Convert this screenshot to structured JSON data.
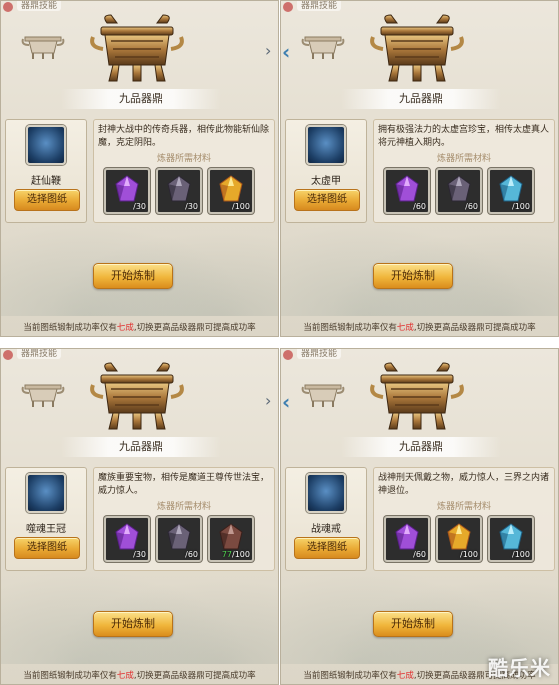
{
  "header_tag": "器鼎技能",
  "cauldron_title": "九品器鼎",
  "materials_label": "炼器所需材料",
  "select_button_label": "选择图纸",
  "craft_button_label": "开始炼制",
  "tip": {
    "before": "当前图纸锻制成功率仅有",
    "rate": "七成",
    "after": ",切换更高品级器鼎可提高成功率"
  },
  "panels": [
    {
      "item_name": "赶仙鞭",
      "description": "封神大战中的传奇兵器，相传此物能斩仙除魔，克定阴阳。",
      "materials": [
        {
          "icon": "purple-crystal-icon",
          "have": "",
          "need": "30"
        },
        {
          "icon": "dark-ore-icon",
          "have": "",
          "need": "30"
        },
        {
          "icon": "golden-crystal-icon",
          "have": "",
          "need": "100"
        }
      ]
    },
    {
      "item_name": "太虚甲",
      "description": "拥有极强法力的太虚宫珍宝，相传太虚真人将元神植入期内。",
      "materials": [
        {
          "icon": "purple-crystal-icon",
          "have": "",
          "need": "60"
        },
        {
          "icon": "dark-ore-icon",
          "have": "",
          "need": "60"
        },
        {
          "icon": "blue-crystal-icon",
          "have": "",
          "need": "100"
        }
      ]
    },
    {
      "item_name": "噬魂王冠",
      "description": "魔族重要宝物，相传是魔道王尊传世法宝，威力惊人。",
      "materials": [
        {
          "icon": "purple-crystal-icon",
          "have": "",
          "need": "30"
        },
        {
          "icon": "dark-ore-icon",
          "have": "",
          "need": "60"
        },
        {
          "icon": "red-ore-icon",
          "have": "77",
          "need": "100"
        }
      ]
    },
    {
      "item_name": "战魂戒",
      "description": "战神刑天佩戴之物，威力惊人，三界之内诸神退位。",
      "materials": [
        {
          "icon": "purple-crystal-icon",
          "have": "",
          "need": "60"
        },
        {
          "icon": "golden-crystal-icon",
          "have": "",
          "need": "100"
        },
        {
          "icon": "blue-crystal-icon",
          "have": "",
          "need": "100"
        }
      ]
    }
  ],
  "site_watermark": "酷乐米"
}
